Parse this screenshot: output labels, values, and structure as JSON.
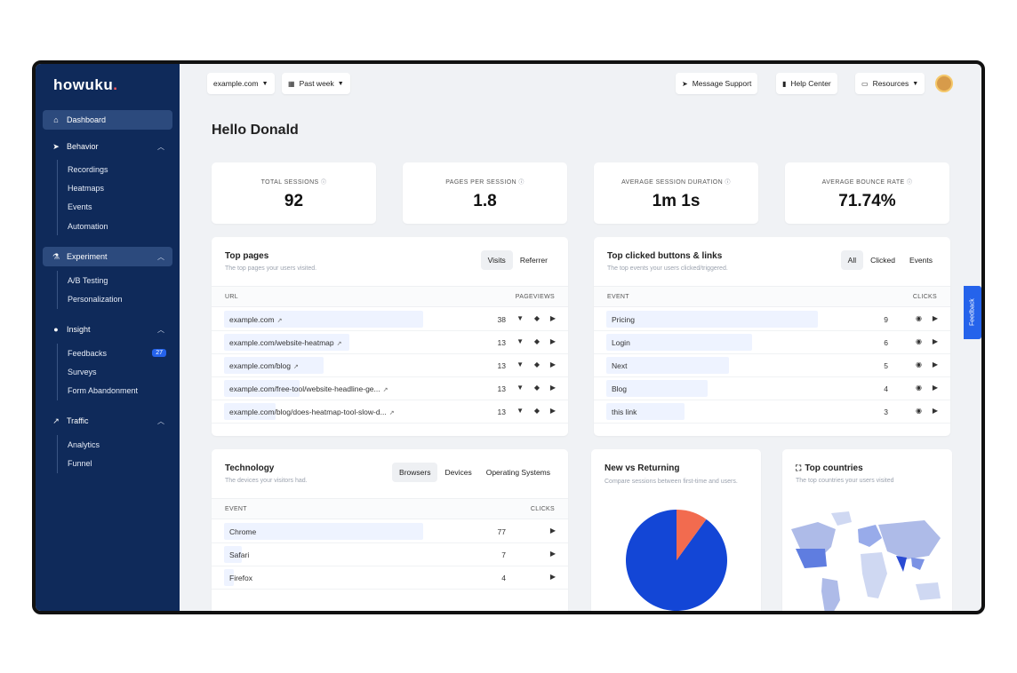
{
  "brand": {
    "name": "howuku",
    "dot": "."
  },
  "sidebar": {
    "dashboard": "Dashboard",
    "behavior": "Behavior",
    "behavior_items": [
      "Recordings",
      "Heatmaps",
      "Events",
      "Automation"
    ],
    "experiment": "Experiment",
    "experiment_items": [
      "A/B Testing",
      "Personalization"
    ],
    "insight": "Insight",
    "insight_items": [
      "Feedbacks",
      "Surveys",
      "Form Abandonment"
    ],
    "feedbacks_badge": "27",
    "traffic": "Traffic",
    "traffic_items": [
      "Analytics",
      "Funnel"
    ]
  },
  "topbar": {
    "site": "example.com",
    "period": "Past week",
    "message_support": "Message Support",
    "help_center": "Help Center",
    "resources": "Resources"
  },
  "greeting": "Hello Donald",
  "stats": [
    {
      "label": "TOTAL SESSIONS",
      "value": "92"
    },
    {
      "label": "PAGES PER SESSION",
      "value": "1.8"
    },
    {
      "label": "AVERAGE SESSION DURATION",
      "value": "1m 1s"
    },
    {
      "label": "AVERAGE BOUNCE RATE",
      "value": "71.74%"
    }
  ],
  "top_pages": {
    "title": "Top pages",
    "subtitle": "The top pages your users visited.",
    "tabs": [
      "Visits",
      "Referrer"
    ],
    "col_left": "URL",
    "col_right": "PAGEVIEWS",
    "rows": [
      {
        "label": "example.com",
        "value": "38",
        "share": 1.0
      },
      {
        "label": "example.com/website-heatmap",
        "value": "13",
        "share": 0.63
      },
      {
        "label": "example.com/blog",
        "value": "13",
        "share": 0.5
      },
      {
        "label": "example.com/free-tool/website-headline-ge...",
        "value": "13",
        "share": 0.38
      },
      {
        "label": "example.com/blog/does-heatmap-tool-slow-d...",
        "value": "13",
        "share": 0.26
      }
    ]
  },
  "top_clicked": {
    "title": "Top clicked buttons & links",
    "subtitle": "The top events your users clicked/triggered.",
    "tabs": [
      "All",
      "Clicked",
      "Events"
    ],
    "col_left": "EVENT",
    "col_right": "CLICKS",
    "rows": [
      {
        "label": "Pricing",
        "value": "9",
        "share": 1.0
      },
      {
        "label": "Login",
        "value": "6",
        "share": 0.69
      },
      {
        "label": "Next",
        "value": "5",
        "share": 0.58
      },
      {
        "label": "Blog",
        "value": "4",
        "share": 0.48
      },
      {
        "label": "this link",
        "value": "3",
        "share": 0.37
      }
    ]
  },
  "technology": {
    "title": "Technology",
    "subtitle": "The devices your visitors had.",
    "tabs": [
      "Browsers",
      "Devices",
      "Operating Systems"
    ],
    "col_left": "EVENT",
    "col_right": "CLICKS",
    "rows": [
      {
        "label": "Chrome",
        "value": "77",
        "share": 1.0
      },
      {
        "label": "Safari",
        "value": "7",
        "share": 0.09
      },
      {
        "label": "Firefox",
        "value": "4",
        "share": 0.05
      }
    ]
  },
  "new_vs_returning": {
    "title": "New vs Returning",
    "subtitle": "Compare sessions between first-time and users.",
    "chart_data": {
      "type": "pie",
      "slices": [
        {
          "value": 90,
          "color": "#1346d6"
        },
        {
          "value": 10,
          "color": "#f26b4f"
        }
      ]
    }
  },
  "top_countries": {
    "title": "Top countries",
    "subtitle": "The top countries your users visited"
  },
  "feedback_tab": "Feedback",
  "colors": {
    "sidebar": "#0f2a5a",
    "accent": "#2563eb",
    "pie_main": "#1346d6",
    "pie_minor": "#f26b4f"
  },
  "icons": {
    "home": "home-icon",
    "pointer": "pointer-icon",
    "flask": "flask-icon",
    "bulb": "bulb-icon",
    "chart": "chart-icon"
  }
}
